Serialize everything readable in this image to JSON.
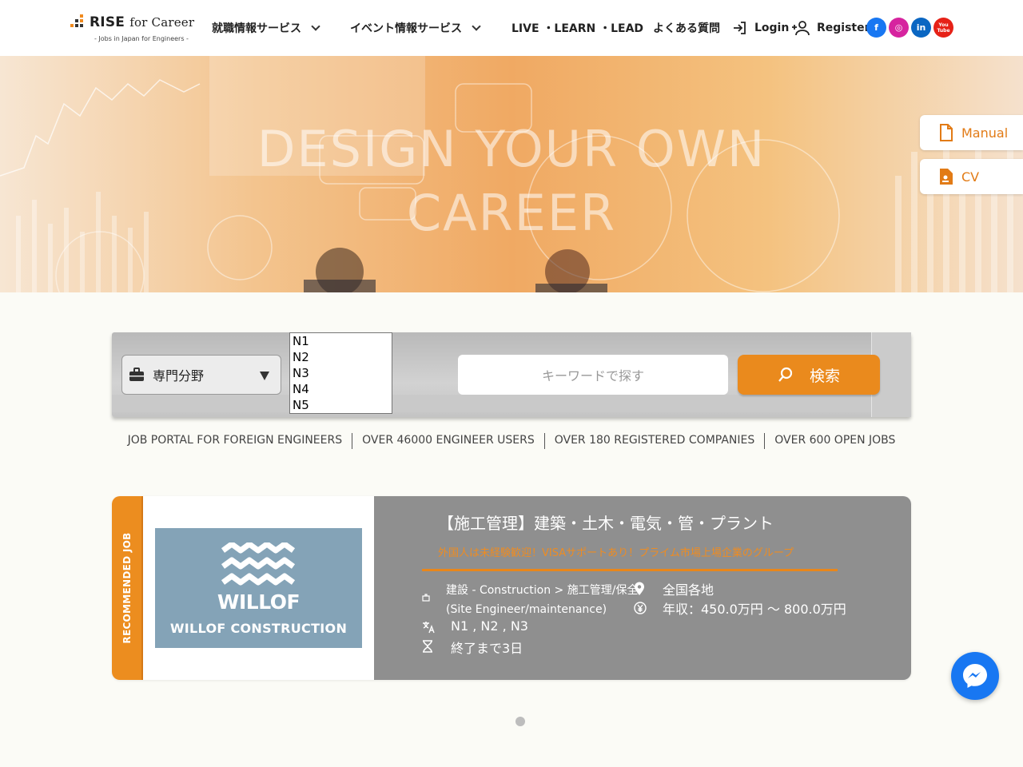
{
  "header": {
    "logo": {
      "brand_bold": "RISE",
      "brand_rest": "for Career",
      "tagline": "- Jobs in Japan for Engineers -"
    },
    "nav": {
      "job_services": "就職情報サービス",
      "event_services": "イベント情報サービス",
      "live_learn_lead": "LIVE ・LEARN ・LEAD",
      "faq": "よくある質問",
      "login": "Login",
      "register": "Register"
    },
    "social": [
      {
        "name": "facebook",
        "label": "f",
        "color": "#1877f2"
      },
      {
        "name": "instagram",
        "label": "◎",
        "color": "#d6249f"
      },
      {
        "name": "linkedin",
        "label": "in",
        "color": "#0a66c2"
      },
      {
        "name": "youtube",
        "label": "You Tube",
        "color": "#e62117"
      }
    ]
  },
  "hero": {
    "line1": "DESIGN YOUR OWN",
    "line2": "CAREER",
    "manual_label": "Manual",
    "cv_label": "CV"
  },
  "search": {
    "field_label": "専門分野",
    "jlpt_options": [
      "N1",
      "N2",
      "N3",
      "N4",
      "N5"
    ],
    "keyword_placeholder": "キーワードで探す",
    "search_label": "検索"
  },
  "stats": [
    "JOB PORTAL FOR FOREIGN ENGINEERS",
    "OVER 46000 ENGINEER USERS",
    "OVER 180 REGISTERED COMPANIES",
    "OVER 600 OPEN JOBS"
  ],
  "job_card": {
    "recommended_label": "RECOMMENDED JOB",
    "company_logo_line1": "WILLOF",
    "company_logo_line2": "WILLOF CONSTRUCTION",
    "title": "【施工管理】建築・土木・電気・管・プラント",
    "tagline": "外国人は未経験歓迎！VISAサポートあり！プライム市場上場企業のグループ",
    "category_line1": "建設 - Construction > 施工管理/保全",
    "category_line2": "(Site Engineer/maintenance)",
    "location": "全国各地",
    "salary": "年収：450.0万円 〜 800.0万円",
    "languages": "N1 , N2 , N3",
    "deadline": "終了まで3日"
  },
  "colors": {
    "accent": "#ea8a1d",
    "card_info_bg": "#8f8f8f",
    "messenger": "#1877f2"
  }
}
